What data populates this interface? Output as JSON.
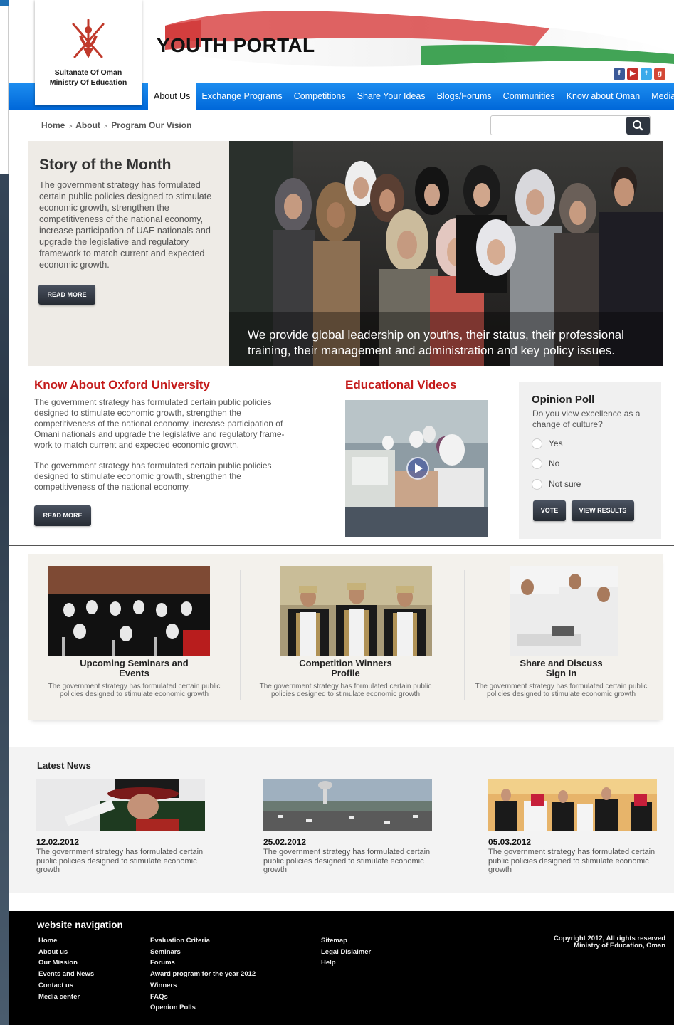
{
  "header": {
    "logo_line1": "Sultanate Of Oman",
    "logo_line2": "Ministry Of Education",
    "site_title": "YOUTH PORTAL",
    "social": [
      "facebook-icon",
      "youtube-icon",
      "twitter-icon",
      "googleplus-icon"
    ]
  },
  "nav": {
    "items": [
      "About Us",
      "Exchange Programs",
      "Competitions",
      "Share Your Ideas",
      "Blogs/Forums",
      "Communities",
      "Know about Oman",
      "Media Center"
    ],
    "active": "About Us"
  },
  "breadcrumb": {
    "home": "Home",
    "about": "About",
    "current": "Program Our Vision"
  },
  "search": {
    "placeholder": ""
  },
  "story": {
    "title": "Story of the Month",
    "text": "The government strategy has formulated certain public policies designed to stimulate economic growth, strengthen the competitiveness of the national economy, increase participation of UAE nationals and upgrade the legislative and regulatory framework to match current and expected economic growth.",
    "button": "READ MORE",
    "caption": "We provide global leadership on youths, their status, their professional training, their management and administration and key policy issues."
  },
  "oxford": {
    "title": "Know About Oxford University",
    "para1": "The government strategy has formulated certain public policies designed to stimulate economic growth, strengthen the competitiveness of the national economy, increase participation of Omani nationals and upgrade the legislative and regulatory frame-work to match current and expected economic growth.",
    "para2": "The government strategy has formulated certain public policies designed to stimulate economic growth, strengthen the competitiveness of the national economy.",
    "button": "READ MORE"
  },
  "videos": {
    "title": "Educational Videos"
  },
  "poll": {
    "title": "Opinion Poll",
    "question": "Do you view excellence as a change of culture?",
    "options": [
      "Yes",
      "No",
      "Not sure"
    ],
    "vote": "VOTE",
    "results": "VIEW RESULTS"
  },
  "features": [
    {
      "title": "Upcoming Seminars and Events",
      "desc": "The government strategy has formulated certain public policies designed to stimulate economic growth"
    },
    {
      "title": "Competition Winners Profile",
      "desc": "The government strategy has formulated certain public policies designed to stimulate economic growth"
    },
    {
      "title": "Share and Discuss Sign In",
      "desc": "The government strategy has formulated certain public policies designed to stimulate economic growth"
    }
  ],
  "news": {
    "title": "Latest News",
    "items": [
      {
        "date": "12.02.2012",
        "desc": "The government strategy has formulated certain public policies designed to stimulate economic growth"
      },
      {
        "date": "25.02.2012",
        "desc": "The government strategy has formulated certain public policies designed to stimulate economic growth"
      },
      {
        "date": "05.03.2012",
        "desc": "The government strategy has formulated certain public policies designed to stimulate economic growth"
      }
    ]
  },
  "footer": {
    "title": "website navigation",
    "col1": [
      "Home",
      "About us",
      "Our Mission",
      "Events and News",
      "Contact us",
      "Media center"
    ],
    "col2": [
      "Evaluation Criteria",
      "Seminars",
      "Forums",
      "Award program for the year 2012",
      "Winners",
      "FAQs",
      "Openion Polls"
    ],
    "col3": [
      "Sitemap",
      "Legal Dislaimer",
      "Help"
    ],
    "copyright1": "Copyright 2012, All rights reserved",
    "copyright2": "Ministry of Education, Oman"
  }
}
